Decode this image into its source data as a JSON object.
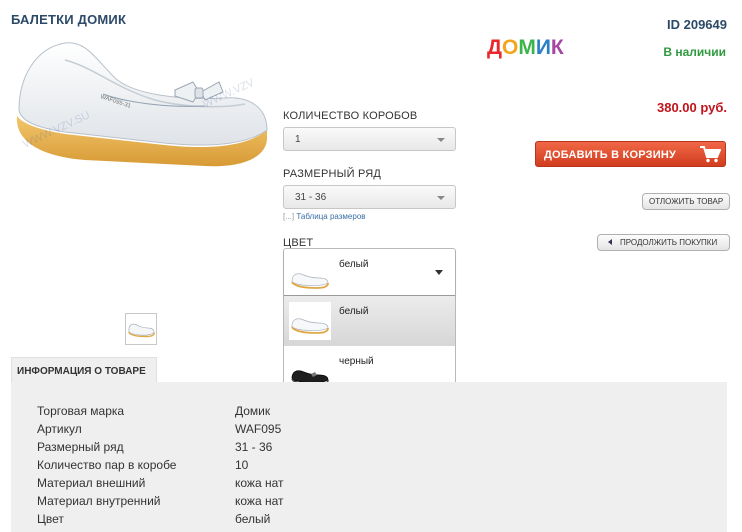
{
  "product": {
    "title": "БАЛЕТКИ ДОМИК",
    "id_label": "ID 209649",
    "stock": "В наличии",
    "price": "380.00 руб."
  },
  "brand_logo": {
    "letters": [
      "Д",
      "О",
      "М",
      "И",
      "К"
    ],
    "colors": [
      "#e8262b",
      "#f5a41c",
      "#3ab54a",
      "#2a7fc7",
      "#a546a3"
    ]
  },
  "options": {
    "boxes_label": "КОЛИЧЕСТВО КОРОБОВ",
    "boxes_value": "1",
    "size_label": "РАЗМЕРНЫЙ РЯД",
    "size_value": "31 - 36",
    "size_table_bracket": "[...]",
    "size_table_link": "Таблица размеров",
    "color_label": "ЦВЕТ",
    "color_selected": "белый",
    "color_options": [
      "белый",
      "черный"
    ]
  },
  "actions": {
    "add_to_cart": "ДОБАВИТЬ В КОРЗИНУ",
    "postpone": "ОТЛОЖИТЬ ТОВАР",
    "continue": "ПРОДОЛЖИТЬ ПОКУПКИ"
  },
  "info": {
    "tab_label": "ИНФОРМАЦИЯ О ТОВАРЕ",
    "rows": [
      {
        "k": "Торговая марка",
        "v": "Домик"
      },
      {
        "k": "Артикул",
        "v": "WAF095"
      },
      {
        "k": "Размерный ряд",
        "v": "31 - 36"
      },
      {
        "k": "Количество пар в коробе",
        "v": "10"
      },
      {
        "k": "Материал внешний",
        "v": "кожа нат"
      },
      {
        "k": "Материал внутренний",
        "v": "кожа нат"
      },
      {
        "k": "Цвет",
        "v": "белый"
      }
    ]
  },
  "colors": {
    "accent_red": "#c0141c",
    "stock_green": "#2f9a3e",
    "title_blue": "#2c4a68"
  }
}
